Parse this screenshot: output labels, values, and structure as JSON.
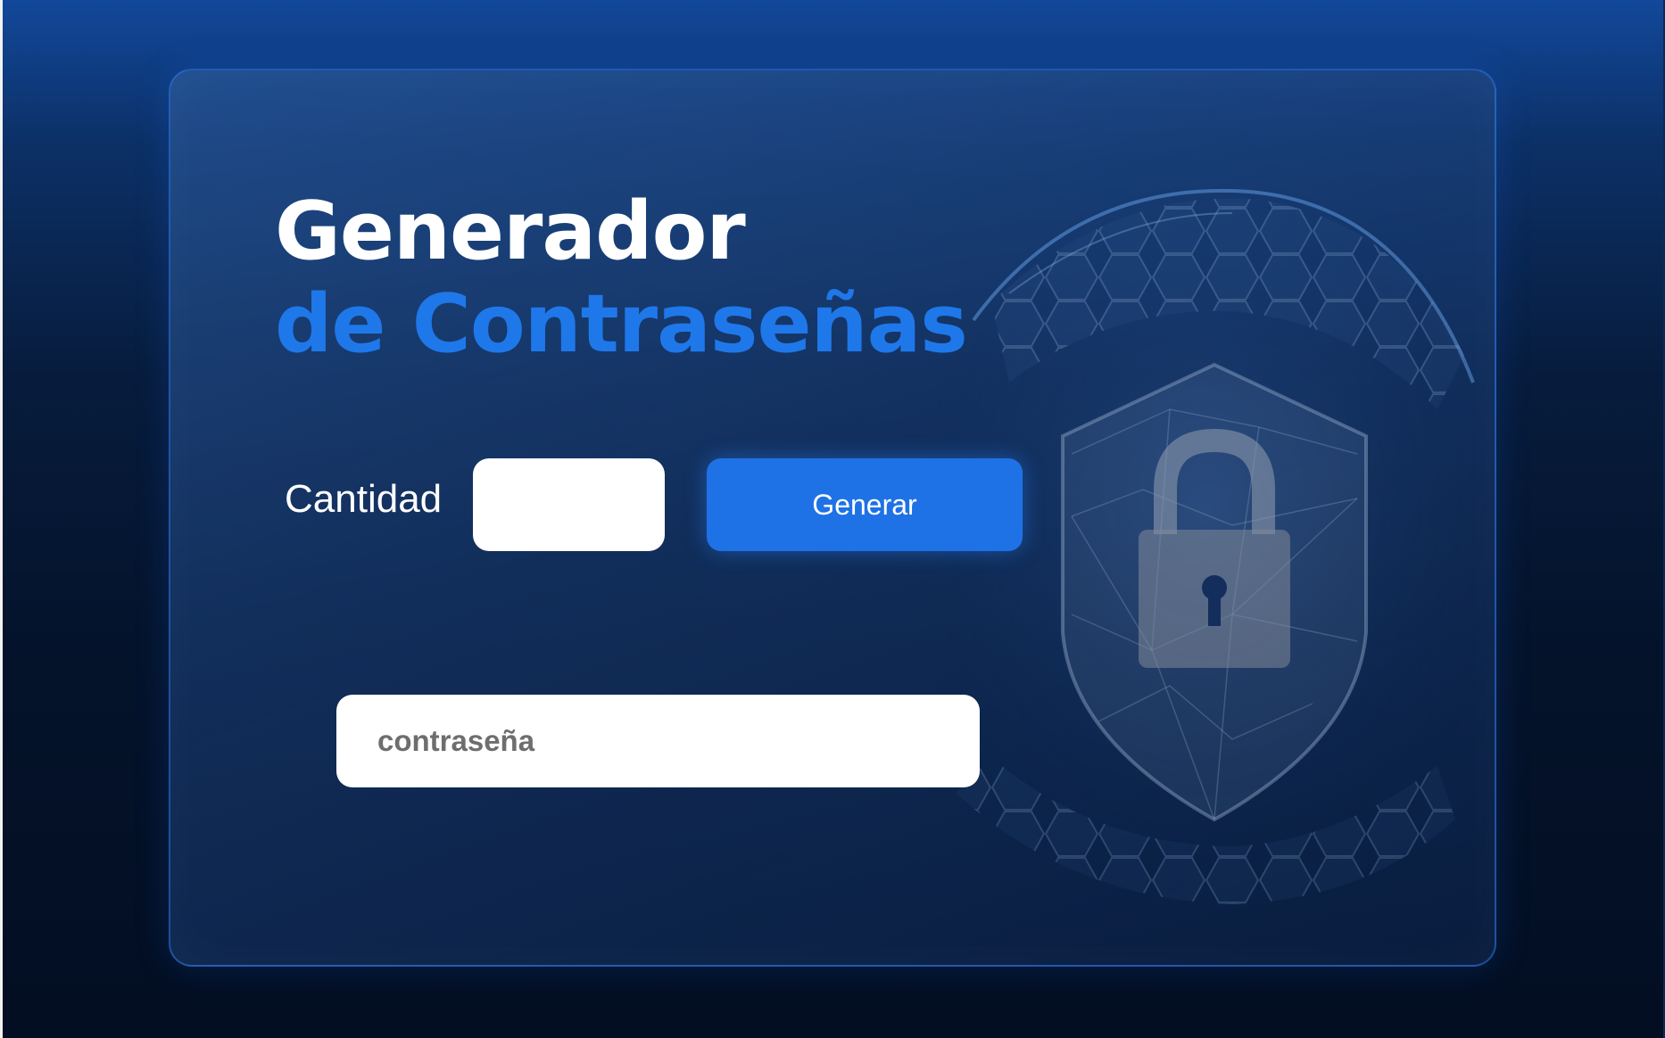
{
  "title": {
    "line1": "Generador",
    "line2": "de Contraseñas"
  },
  "form": {
    "quantity_label": "Cantidad",
    "quantity_value": "",
    "generate_label": "Generar",
    "password_placeholder": "contraseña",
    "password_value": ""
  },
  "colors": {
    "accent": "#1f72e6",
    "title_accent": "#1f78ea",
    "background_dark": "#04132b",
    "background_top": "#12489a"
  },
  "icons": {
    "illustration": "shield-lock-globe-icon"
  }
}
